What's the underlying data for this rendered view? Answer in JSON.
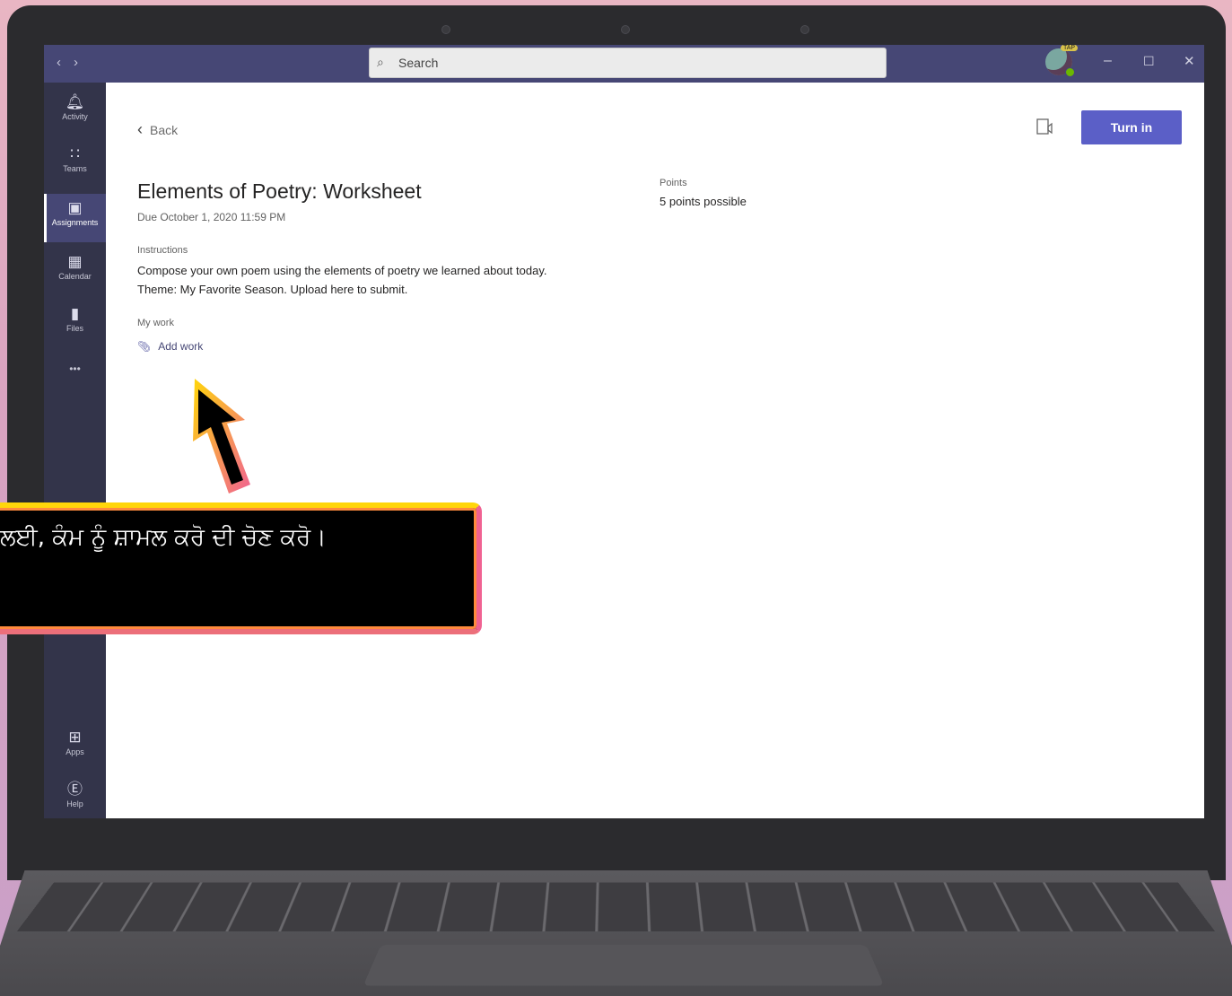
{
  "titlebar": {
    "nav_back": "‹",
    "nav_forward": "›",
    "search_placeholder": "Search",
    "avatar_badge": "TAP",
    "window_controls": [
      "–",
      "☐",
      "✕"
    ]
  },
  "rail": {
    "items": [
      {
        "label": "Activity",
        "icon": "bell-icon"
      },
      {
        "label": "Teams",
        "icon": "teams-icon"
      },
      {
        "label": "Assignments",
        "icon": "assignments-icon",
        "active": true
      },
      {
        "label": "Calendar",
        "icon": "calendar-icon"
      },
      {
        "label": "Files",
        "icon": "files-icon"
      }
    ],
    "more": "•••",
    "bottom_items": [
      {
        "label": "Apps",
        "icon": "apps-icon"
      },
      {
        "label": "Help",
        "icon": "help-icon"
      }
    ]
  },
  "assignment": {
    "back_label": "Back",
    "title": "Elements of Poetry: Worksheet",
    "due": "Due October 1, 2020 11:59 PM",
    "instructions_label": "Instructions",
    "instructions_line1": "Compose your own poem using the elements of poetry we learned about today.",
    "instructions_line2": "Theme: My Favorite Season. Upload here to submit.",
    "my_work_label": "My work",
    "add_work_label": "Add work",
    "points_label": "Points",
    "points_value": "5 points possible",
    "turn_in_label": "Turn in"
  },
  "callout": {
    "text": "ਲਈ, ਕੰਮ ਨੂੰ ਸ਼ਾਮਲ ਕਰੋ ਦੀ ਚੋਣ ਕਰੋ।"
  },
  "colors": {
    "teams_purple": "#464775",
    "rail": "#33344a",
    "turn_in": "#5b5fc7",
    "callout_border_top": "#ffd60a",
    "callout_border_right": "#f06292"
  }
}
